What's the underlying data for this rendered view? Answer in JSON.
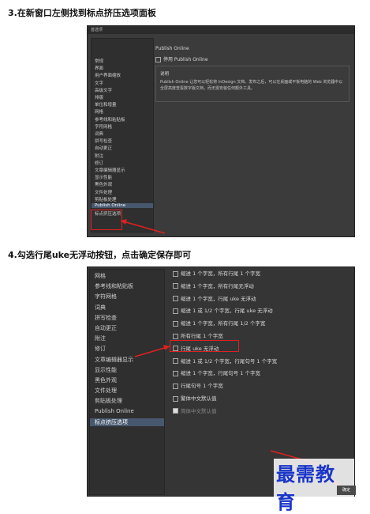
{
  "steps": {
    "step1": "3.在新窗口左侧找到标点挤压选项面板",
    "step2": "4.勾选行尾uke无浮动按钮，点击确定保存即可"
  },
  "shot1": {
    "title": "首选项",
    "nav": [
      "常规",
      "界面",
      "用户界面缩放",
      "文字",
      "高级文字",
      "排版",
      "单位和增量",
      "网格",
      "参考线和粘贴板",
      "字符网格",
      "词典",
      "拼写检查",
      "自动更正",
      "附注",
      "修订",
      "文章编辑器显示",
      "显示性能",
      "黑色外观",
      "文件处理",
      "剪贴板处理",
      "Publish Online",
      "标点挤压选项"
    ],
    "panel_title": "Publish Online",
    "enable_label": "停用 Publish Online",
    "desc_title": "说明",
    "desc_text": "Publish Online 让您可以轻松将 InDesign 文档、发布之后，可以在桌面或平板电脑的 Web 浏览器中以全屏高度查看数字版文档，而无需安装任何额外工具。"
  },
  "shot2": {
    "nav": [
      "网格",
      "参考线和粘贴板",
      "字符网格",
      "词典",
      "拼写检查",
      "自动更正",
      "附注",
      "修订",
      "文章编辑器显示",
      "显示性能",
      "黑色外观",
      "文件处理",
      "剪贴板处理",
      "Publish Online",
      "标点挤压选项"
    ],
    "options": [
      {
        "label": "缩进 1 个字宽，所有行尾 1 个字宽",
        "checked": false,
        "disabled": false
      },
      {
        "label": "缩进 1 个字宽，所有行尾无浮动",
        "checked": false,
        "disabled": false
      },
      {
        "label": "缩进 1 个字宽，行尾 uke 无浮动",
        "checked": false,
        "disabled": false
      },
      {
        "label": "缩进 1 或 1/2 个字宽，行尾 uke 无浮动",
        "checked": false,
        "disabled": false
      },
      {
        "label": "缩进 1 个字宽，所有行尾 1/2 个字宽",
        "checked": false,
        "disabled": false
      },
      {
        "label": "所有行尾 1 个字宽",
        "checked": false,
        "disabled": false
      },
      {
        "label": "行尾 uke 无浮动",
        "checked": false,
        "disabled": false
      },
      {
        "label": "缩进 1 或 1/2 个字宽，行尾句号 1 个字宽",
        "checked": false,
        "disabled": false
      },
      {
        "label": "缩进 1 个字宽，行尾句号 1 个字宽",
        "checked": false,
        "disabled": false
      },
      {
        "label": "行尾句号 1 个字宽",
        "checked": false,
        "disabled": false
      },
      {
        "label": "繁体中文默认值",
        "checked": false,
        "disabled": false
      },
      {
        "label": "简体中文默认值",
        "checked": true,
        "disabled": true
      }
    ],
    "watermark": "最需教育",
    "ok_label": "确定"
  },
  "colors": {
    "annotation": "#e02020",
    "watermark": "#1a35c8",
    "selected": "#47586e"
  }
}
